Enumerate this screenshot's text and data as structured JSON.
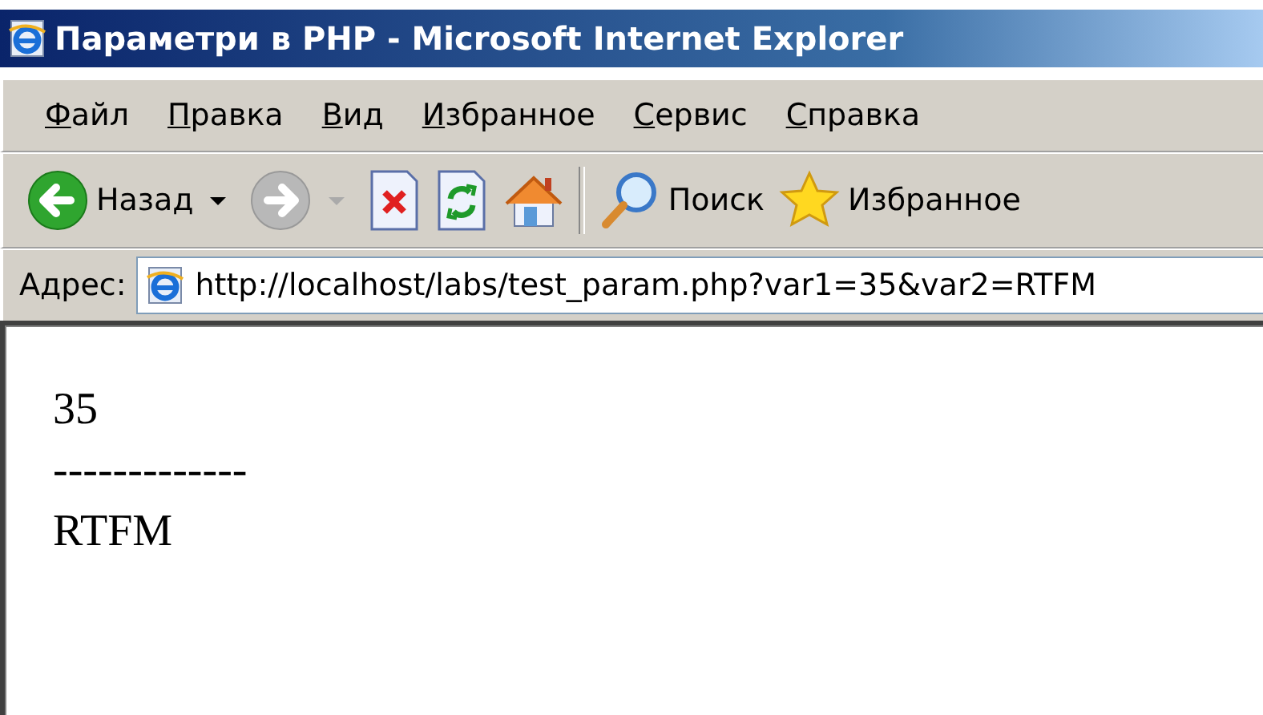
{
  "window": {
    "title": "Параметри в PHP - Microsoft Internet Explorer"
  },
  "menu": [
    "Файл",
    "Правка",
    "Вид",
    "Избранное",
    "Сервис",
    "Справка"
  ],
  "toolbar": [
    {
      "kind": "back",
      "label": "Назад",
      "disabled": false,
      "dropdown": true
    },
    {
      "kind": "forward",
      "disabled": true,
      "dropdown": true
    },
    {
      "kind": "stop"
    },
    {
      "kind": "refresh"
    },
    {
      "kind": "home"
    },
    {
      "kind": "separator"
    },
    {
      "kind": "search",
      "label": "Поиск"
    },
    {
      "kind": "favorites",
      "label": "Избранное"
    }
  ],
  "address_bar": {
    "label": "Адрес:",
    "value": "http://localhost/labs/test_param.php?var1=35&var2=RTFM"
  },
  "page": {
    "lines": [
      "35",
      "-------------",
      "RTFM"
    ]
  }
}
